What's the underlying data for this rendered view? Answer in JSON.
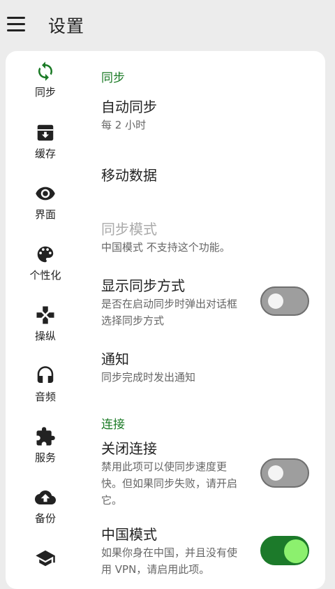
{
  "header": {
    "title": "设置",
    "menu_icon": "hamburger-menu-icon"
  },
  "nav": {
    "items": [
      {
        "label": "同步",
        "icon": "sync-icon",
        "selected": true,
        "color": "#1a7a25"
      },
      {
        "label": "缓存",
        "icon": "archive-icon"
      },
      {
        "label": "界面",
        "icon": "eye-icon"
      },
      {
        "label": "个性化",
        "icon": "palette-icon"
      },
      {
        "label": "操纵",
        "icon": "gamepad-icon"
      },
      {
        "label": "音频",
        "icon": "headphones-icon"
      },
      {
        "label": "服务",
        "icon": "puzzle-icon"
      },
      {
        "label": "备份",
        "icon": "cloud-upload-icon"
      },
      {
        "label": "",
        "icon": "school-icon"
      }
    ]
  },
  "sections": {
    "sync": {
      "header": "同步"
    },
    "connection": {
      "header": "连接"
    }
  },
  "settings": {
    "auto_sync": {
      "title": "自动同步",
      "subtitle": "每 2 小时"
    },
    "mobile_data": {
      "title": "移动数据"
    },
    "sync_mode": {
      "title": "同步模式",
      "subtitle": "中国模式 不支持这个功能。",
      "enabled": false
    },
    "show_sync_method": {
      "title": "显示同步方式",
      "subtitle": "是否在启动同步时弹出对话框选择同步方式",
      "toggle": false
    },
    "notification": {
      "title": "通知",
      "subtitle": "同步完成时发出通知"
    },
    "close_connection": {
      "title": "关闭连接",
      "subtitle": "禁用此项可以使同步速度更快。但如果同步失败，请开启它。",
      "toggle": false
    },
    "china_mode": {
      "title": "中国模式",
      "subtitle": "如果你身在中国，并且没有使用 VPN，请启用此项。",
      "toggle": true
    }
  },
  "colors": {
    "accent": "#1a7a25",
    "toggle_on_track": "#1c7a2a",
    "toggle_on_knob": "#8cf06e",
    "toggle_off_track": "#9e9e9e",
    "background": "#ececec",
    "card": "#ffffff"
  }
}
